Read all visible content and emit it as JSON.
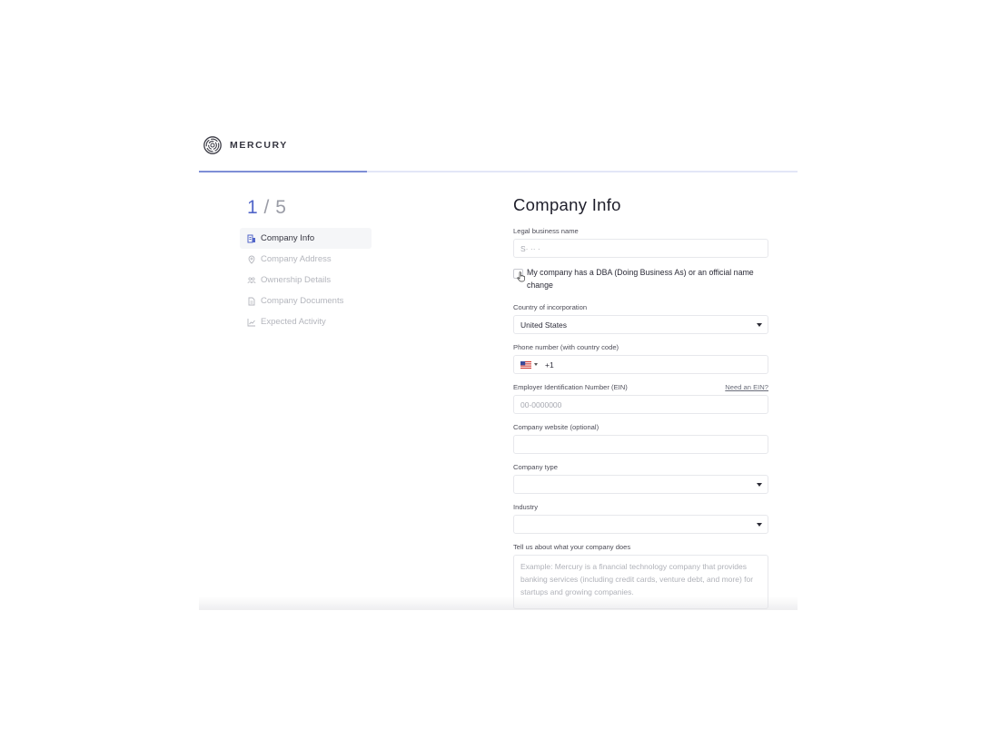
{
  "brand": {
    "name": "MERCURY",
    "logo_icon": "mercury-maze-logo-icon"
  },
  "progress": {
    "current_step": 1,
    "total_steps": 5,
    "fraction": 0.28
  },
  "sidebar": {
    "counter_current": "1",
    "counter_total": "/ 5",
    "steps": [
      {
        "label": "Company Info",
        "icon": "building-icon",
        "active": true
      },
      {
        "label": "Company Address",
        "icon": "location-pin-icon",
        "active": false
      },
      {
        "label": "Ownership Details",
        "icon": "people-icon",
        "active": false
      },
      {
        "label": "Company Documents",
        "icon": "document-icon",
        "active": false
      },
      {
        "label": "Expected Activity",
        "icon": "chart-icon",
        "active": false
      }
    ]
  },
  "form": {
    "title": "Company Info",
    "legal_name": {
      "label": "Legal business name",
      "value": "S· ·· ·"
    },
    "dba_checkbox": {
      "label": "My company has a DBA (Doing Business As) or an official name change",
      "checked": false
    },
    "country": {
      "label": "Country of incorporation",
      "value": "United States"
    },
    "phone": {
      "label": "Phone number (with country code)",
      "flag_icon": "us-flag-icon",
      "code": "+1"
    },
    "ein": {
      "label": "Employer Identification Number (EIN)",
      "link": "Need an EIN?",
      "placeholder": "00-0000000"
    },
    "website": {
      "label": "Company website (optional)",
      "value": ""
    },
    "company_type": {
      "label": "Company type",
      "value": ""
    },
    "industry": {
      "label": "Industry",
      "value": ""
    },
    "description": {
      "label": "Tell us about what your company does",
      "placeholder": "Example: Mercury is a financial technology company that provides banking services (including credit cards, venture debt, and more) for startups and growing companies."
    }
  },
  "colors": {
    "accent": "#5266c9",
    "progress": "#7e8ed6",
    "track": "#e3e6f7"
  }
}
